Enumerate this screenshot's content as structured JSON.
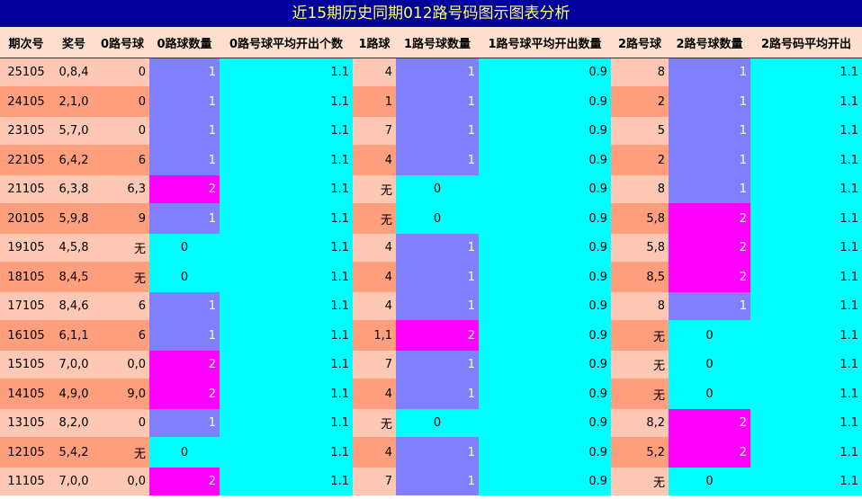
{
  "title": "近15期历史同期012路号码图示图表分析",
  "headers": [
    "期次号",
    "奖号",
    "0路号球",
    "0路球数量",
    "0路号球平均开出个数",
    "1路球",
    "1路号球数量",
    "1路号球平均开出数量",
    "2路号球",
    "2路号球数量",
    "2路号码平均开出"
  ],
  "rows": [
    {
      "period": "25105",
      "prize": "0,8,4",
      "r0": "0",
      "c0": "1",
      "a0": "1.1",
      "r1": "4",
      "c1": "1",
      "a1": "0.9",
      "r2": "8",
      "c2": "1",
      "a2": "1.1"
    },
    {
      "period": "24105",
      "prize": "2,1,0",
      "r0": "0",
      "c0": "1",
      "a0": "1.1",
      "r1": "1",
      "c1": "1",
      "a1": "0.9",
      "r2": "2",
      "c2": "1",
      "a2": "1.1"
    },
    {
      "period": "23105",
      "prize": "5,7,0",
      "r0": "0",
      "c0": "1",
      "a0": "1.1",
      "r1": "7",
      "c1": "1",
      "a1": "0.9",
      "r2": "5",
      "c2": "1",
      "a2": "1.1"
    },
    {
      "period": "22105",
      "prize": "6,4,2",
      "r0": "6",
      "c0": "1",
      "a0": "1.1",
      "r1": "4",
      "c1": "1",
      "a1": "0.9",
      "r2": "2",
      "c2": "1",
      "a2": "1.1"
    },
    {
      "period": "21105",
      "prize": "6,3,8",
      "r0": "6,3",
      "c0": "2",
      "a0": "1.1",
      "r1": "无",
      "c1": "0",
      "a1": "0.9",
      "r2": "8",
      "c2": "1",
      "a2": "1.1"
    },
    {
      "period": "20105",
      "prize": "5,9,8",
      "r0": "9",
      "c0": "1",
      "a0": "1.1",
      "r1": "无",
      "c1": "0",
      "a1": "0.9",
      "r2": "5,8",
      "c2": "2",
      "a2": "1.1"
    },
    {
      "period": "19105",
      "prize": "4,5,8",
      "r0": "无",
      "c0": "0",
      "a0": "1.1",
      "r1": "4",
      "c1": "1",
      "a1": "0.9",
      "r2": "5,8",
      "c2": "2",
      "a2": "1.1"
    },
    {
      "period": "18105",
      "prize": "8,4,5",
      "r0": "无",
      "c0": "0",
      "a0": "1.1",
      "r1": "4",
      "c1": "1",
      "a1": "0.9",
      "r2": "8,5",
      "c2": "2",
      "a2": "1.1"
    },
    {
      "period": "17105",
      "prize": "8,4,6",
      "r0": "6",
      "c0": "1",
      "a0": "1.1",
      "r1": "4",
      "c1": "1",
      "a1": "0.9",
      "r2": "8",
      "c2": "1",
      "a2": "1.1"
    },
    {
      "period": "16105",
      "prize": "6,1,1",
      "r0": "6",
      "c0": "1",
      "a0": "1.1",
      "r1": "1,1",
      "c1": "2",
      "a1": "0.9",
      "r2": "无",
      "c2": "0",
      "a2": "1.1"
    },
    {
      "period": "15105",
      "prize": "7,0,0",
      "r0": "0,0",
      "c0": "2",
      "a0": "1.1",
      "r1": "7",
      "c1": "1",
      "a1": "0.9",
      "r2": "无",
      "c2": "0",
      "a2": "1.1"
    },
    {
      "period": "14105",
      "prize": "4,9,0",
      "r0": "9,0",
      "c0": "2",
      "a0": "1.1",
      "r1": "4",
      "c1": "1",
      "a1": "0.9",
      "r2": "无",
      "c2": "0",
      "a2": "1.1"
    },
    {
      "period": "13105",
      "prize": "8,2,0",
      "r0": "0",
      "c0": "1",
      "a0": "1.1",
      "r1": "无",
      "c1": "0",
      "a1": "0.9",
      "r2": "8,2",
      "c2": "2",
      "a2": "1.1"
    },
    {
      "period": "12105",
      "prize": "5,4,2",
      "r0": "无",
      "c0": "0",
      "a0": "1.1",
      "r1": "4",
      "c1": "1",
      "a1": "0.9",
      "r2": "5,2",
      "c2": "2",
      "a2": "1.1"
    },
    {
      "period": "11105",
      "prize": "7,0,0",
      "r0": "0,0",
      "c0": "2",
      "a0": "1.1",
      "r1": "7",
      "c1": "1",
      "a1": "0.9",
      "r2": "无",
      "c2": "0",
      "a2": "1.1"
    }
  ],
  "colors": {
    "title_bg": "#00009c",
    "title_text": "#ffff66",
    "header_bg": "#ffe0cf",
    "row_light": "#ffc8b4",
    "row_dark": "#ff9f7e",
    "count_0": "#00ffff",
    "count_1": "#8080ff",
    "count_2": "#ff00ff"
  }
}
